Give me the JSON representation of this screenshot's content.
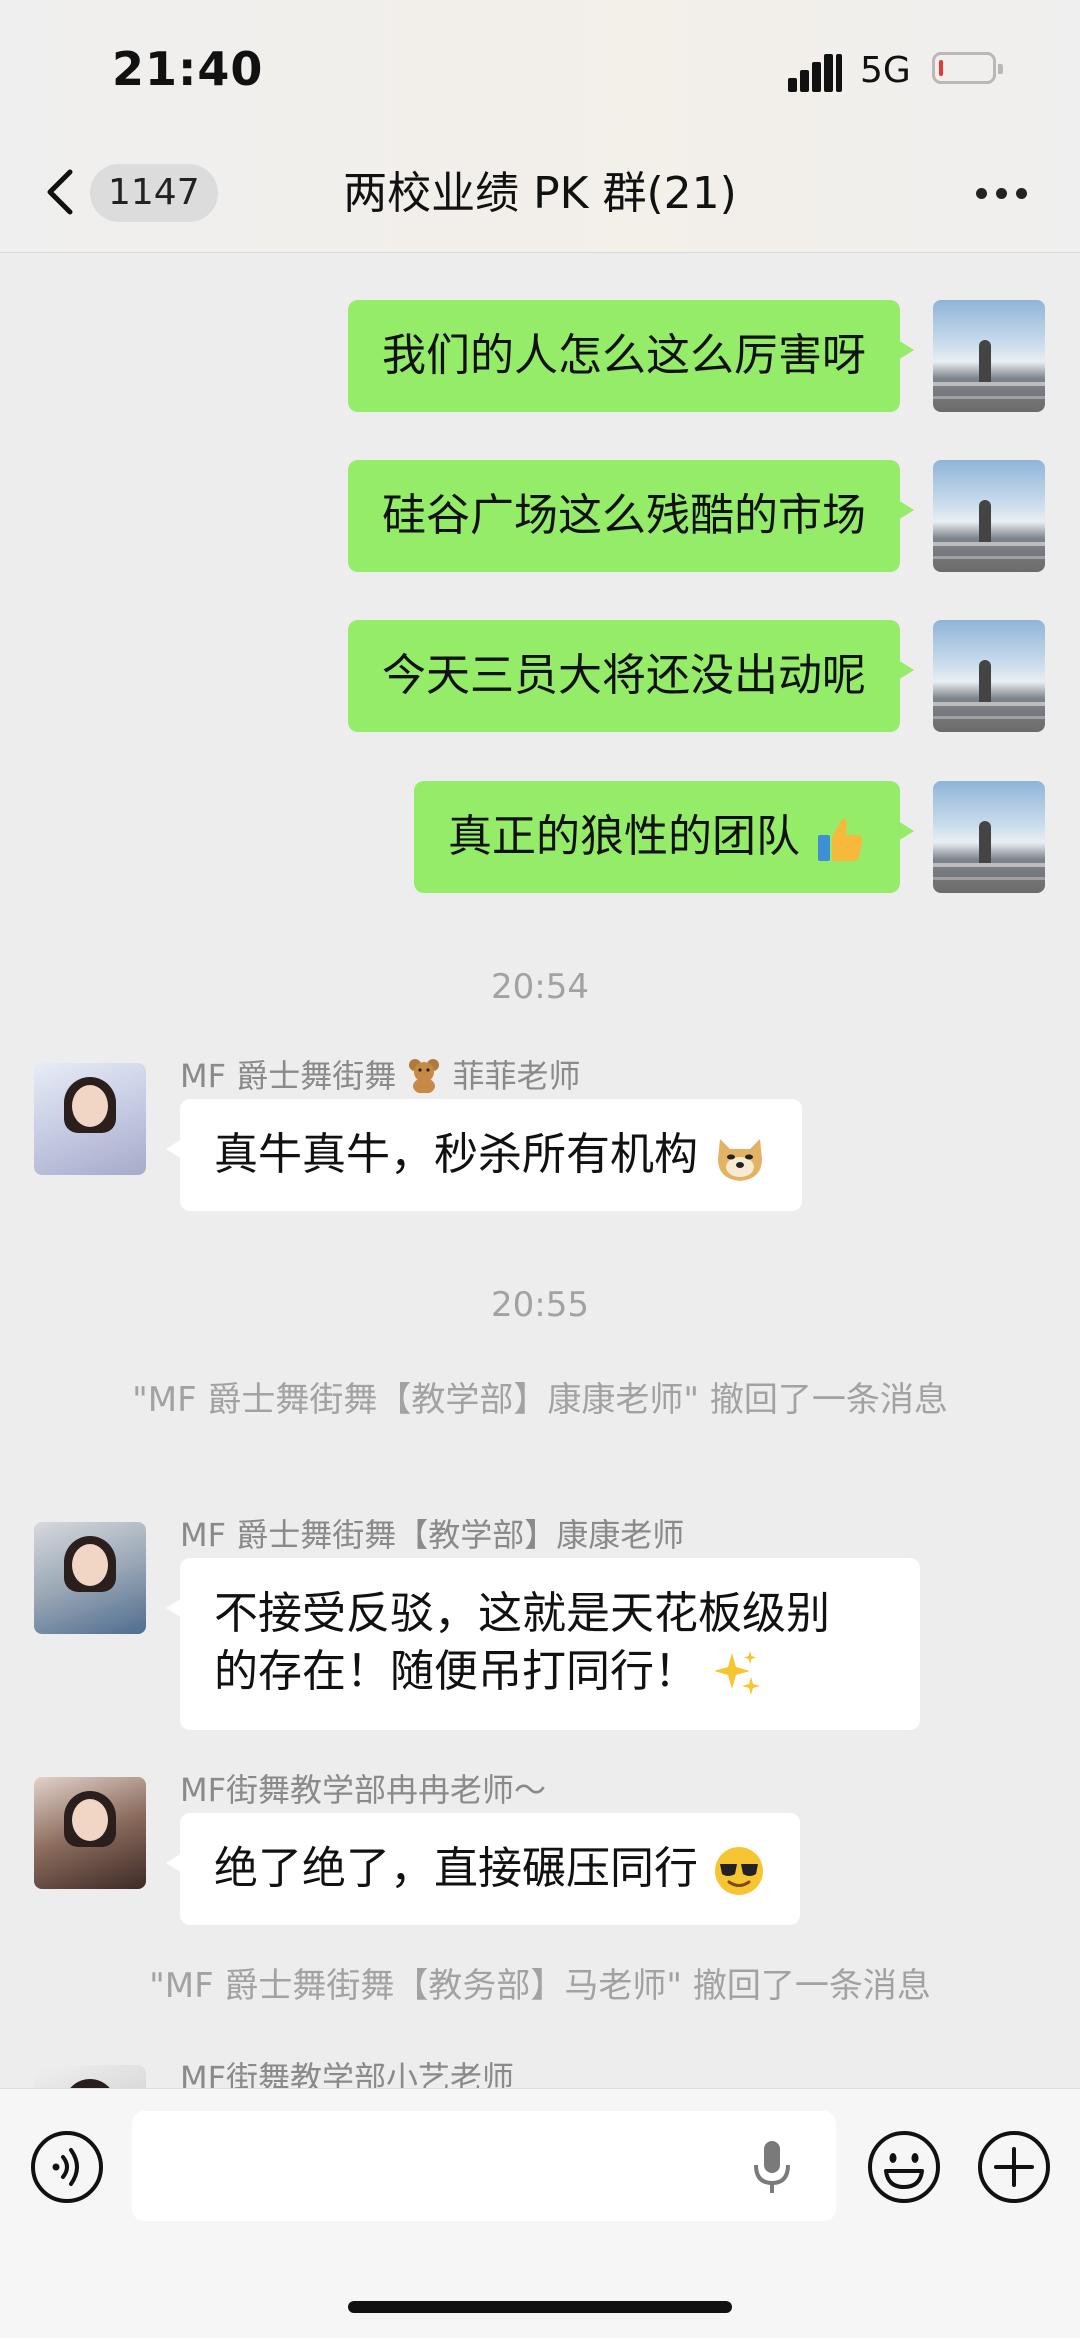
{
  "status_bar": {
    "time": "21:40",
    "network": "5G"
  },
  "nav": {
    "badge": "1147",
    "title": "两校业绩 PK 群(21)"
  },
  "messages_me": [
    {
      "text": "我们的人怎么这么厉害呀"
    },
    {
      "text": "硅谷广场这么残酷的市场"
    },
    {
      "text": "今天三员大将还没出动呢"
    },
    {
      "text": "真正的狼性的团队"
    }
  ],
  "timestamps": [
    "20:54",
    "20:55"
  ],
  "messages_other": [
    {
      "sender": "MF 爵士舞街舞",
      "sender_suffix": "菲菲老师",
      "text": "真牛真牛，秒杀所有机构"
    },
    {
      "sender": "MF 爵士舞街舞【教学部】康康老师",
      "text_line1": "不接受反驳，这就是天花板级别",
      "text_line2": "的存在！随便吊打同行！"
    },
    {
      "sender": "MF街舞教学部冉冉老师～",
      "text": "绝了绝了，直接碾压同行"
    },
    {
      "sender": "MF街舞教学部小艺老师"
    }
  ],
  "recalls": [
    "\"MF 爵士舞街舞【教学部】康康老师\" 撤回了一条消息",
    "\"MF 爵士舞街舞【教务部】马老师\" 撤回了一条消息"
  ],
  "input": {
    "placeholder": ""
  },
  "colors": {
    "my_bubble": "#95ec69",
    "other_bubble": "#ffffff",
    "background": "#ededed"
  },
  "icons": [
    "back-icon",
    "more-icon",
    "thumbs-up-icon",
    "doge-icon",
    "sparkles-icon",
    "sunglasses-icon",
    "teddy-bear-icon",
    "voice-icon",
    "mic-icon",
    "emoji-icon",
    "plus-icon"
  ]
}
